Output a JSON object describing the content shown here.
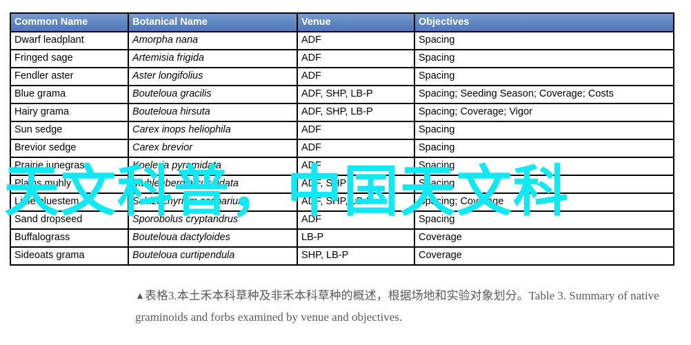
{
  "table": {
    "headers": [
      "Common Name",
      "Botanical  Name",
      "Venue",
      "Objectives"
    ],
    "rows": [
      {
        "common": "Dwarf leadplant",
        "botanical": "Amorpha nana",
        "venue": "ADF",
        "objectives": "Spacing"
      },
      {
        "common": "Fringed sage",
        "botanical": "Artemisia frigida",
        "venue": "ADF",
        "objectives": "Spacing"
      },
      {
        "common": "Fendler aster",
        "botanical": "Aster longifolius",
        "venue": "ADF",
        "objectives": "Spacing"
      },
      {
        "common": "Blue grama",
        "botanical": "Bouteloua gracilis",
        "venue": "ADF, SHP, LB-P",
        "objectives": "Spacing; Seeding Season;  Coverage; Costs"
      },
      {
        "common": "Hairy grama",
        "botanical": "Bouteloua hirsuta",
        "venue": "ADF, SHP, LB-P",
        "objectives": "Spacing; Coverage; Vigor"
      },
      {
        "common": "Sun sedge",
        "botanical": "Carex inops heliophila",
        "venue": "ADF",
        "objectives": "Spacing"
      },
      {
        "common": "Brevior sedge",
        "botanical": "Carex brevior",
        "venue": "ADF",
        "objectives": "Spacing"
      },
      {
        "common": "Prairie junegrass",
        "botanical": "Koeleria pyramidata",
        "venue": "ADF",
        "objectives": "Spacing"
      },
      {
        "common": "Plains muhly",
        "botanical": "Muhlenbergia cuspidata",
        "venue": "ADF, SHP",
        "objectives": "Spacing"
      },
      {
        "common": "Little bluestem",
        "botanical": "Schizachyrium scoparium",
        "venue": "ADF, SHP, LB-P",
        "objectives": "Spacing; Coverage"
      },
      {
        "common": "Sand dropseed",
        "botanical": "Sporobolus cryptandrus",
        "venue": "ADF",
        "objectives": "Spacing"
      },
      {
        "common": "Buffalograss",
        "botanical": "Bouteloua dactyloides",
        "venue": "LB-P",
        "objectives": "Coverage"
      },
      {
        "common": "Sideoats grama",
        "botanical": "Bouteloua curtipendula",
        "venue": "SHP, LB-P",
        "objectives": "Coverage"
      }
    ]
  },
  "caption": {
    "marker": "▲",
    "text": "表格3.本土禾本科草种及非禾本科草种的概述，根据场地和实验对象划分。Table 3. Summary of native graminoids and forbs examined by venue and objectives."
  },
  "watermark": {
    "text": "天文科普，中国天文科",
    "color": "#12e8f2"
  },
  "colors": {
    "header_blue": "#5a84c0",
    "border": "#000000",
    "caption_gray": "#595959",
    "watermark_cyan": "#12e8f2"
  }
}
